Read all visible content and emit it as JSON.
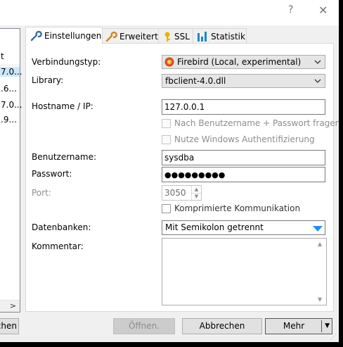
{
  "titlebar": {
    "help": "?",
    "close": "✕"
  },
  "left_panel": {
    "header": "t",
    "rows": [
      "7.0...",
      ".6...",
      "7.0...",
      ".9..."
    ],
    "scroll_right": ">",
    "button": "chen"
  },
  "tabs": [
    {
      "label": "Einstellungen",
      "icon": "wrench-icon"
    },
    {
      "label": "Erweitert",
      "icon": "wrench-orange-icon"
    },
    {
      "label": "SSL",
      "icon": "key-icon"
    },
    {
      "label": "Statistik",
      "icon": "bar-chart-icon"
    }
  ],
  "form": {
    "connection_type_label": "Verbindungstyp:",
    "connection_type_value": "Firebird (Local, experimental)",
    "library_label": "Library:",
    "library_value": "fbclient-4.0.dll",
    "hostname_label": "Hostname / IP:",
    "hostname_value": "127.0.0.1",
    "ask_credentials_label": "Nach Benutzername + Passwort fragen",
    "windows_auth_label": "Nutze Windows Authentifizierung",
    "username_label": "Benutzername:",
    "username_value": "sysdba",
    "password_label": "Passwort:",
    "password_value": "●●●●●●●●●",
    "port_label": "Port:",
    "port_value": "3050",
    "compression_label": "Komprimierte Kommunikation",
    "databases_label": "Datenbanken:",
    "databases_value": "Mit Semikolon getrennt",
    "comment_label": "Kommentar:"
  },
  "buttons": {
    "open": "Öffnen.",
    "cancel": "Abbrechen",
    "more": "Mehr"
  },
  "colors": {
    "accent_arrow": "#1e90ff",
    "selection": "#cce8ff"
  }
}
